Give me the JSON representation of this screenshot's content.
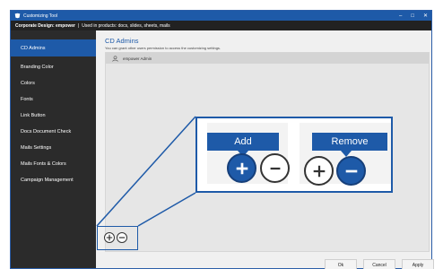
{
  "window": {
    "title": "Customizing Tool",
    "controls": [
      "–",
      "□",
      "✕"
    ]
  },
  "subbar": {
    "design_label": "Corporate Design:",
    "design_value": "empower",
    "separator": "|",
    "products_label": "Used in products:",
    "products_value": "docs, slides, sheets, mails"
  },
  "sidebar": {
    "items": [
      {
        "label": "CD Admins",
        "active": true
      },
      {
        "label": "Branding Color"
      },
      {
        "label": "Colors"
      },
      {
        "label": "Fonts"
      },
      {
        "label": "Link Button"
      },
      {
        "label": "Docs Document Check"
      },
      {
        "label": "Mails Settings"
      },
      {
        "label": "Mails Fonts & Colors"
      },
      {
        "label": "Campaign Management"
      }
    ]
  },
  "main": {
    "title": "CD Admins",
    "description": "You can grant other users permission to access the customizing settings.",
    "list": [
      {
        "name": "empower Admin",
        "icon": "user-icon"
      }
    ]
  },
  "callout": {
    "add_label": "Add",
    "remove_label": "Remove"
  },
  "footer": {
    "ok": "Ok",
    "cancel": "Cancel",
    "apply": "Apply"
  },
  "colors": {
    "accent": "#1e5aa8",
    "sidebar_bg": "#2b2b2b",
    "subbar_bg": "#222222"
  }
}
